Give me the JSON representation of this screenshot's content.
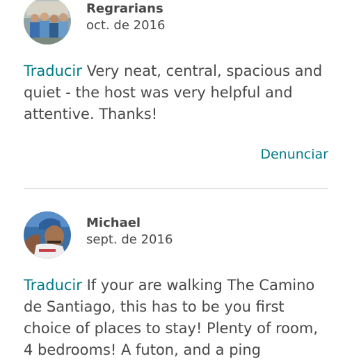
{
  "reviews": [
    {
      "name": "Regrarians",
      "date": "oct. de 2016",
      "translate_label": "Traducir",
      "text": " Very neat, central, spacious and quiet - the host was very helpful and attentive. Thanks!",
      "report_label": "Denunciar"
    },
    {
      "name": "Michael",
      "date": "sept. de 2016",
      "translate_label": "Traducir",
      "text": " If your are walking The Camino de Santiago, this has to be you first choice of places to stay! Plenty of room, 4 bedrooms! A futon, and a ping"
    }
  ],
  "colors": {
    "link": "#007a87",
    "text": "#484848",
    "divider": "#e4e4e4"
  }
}
